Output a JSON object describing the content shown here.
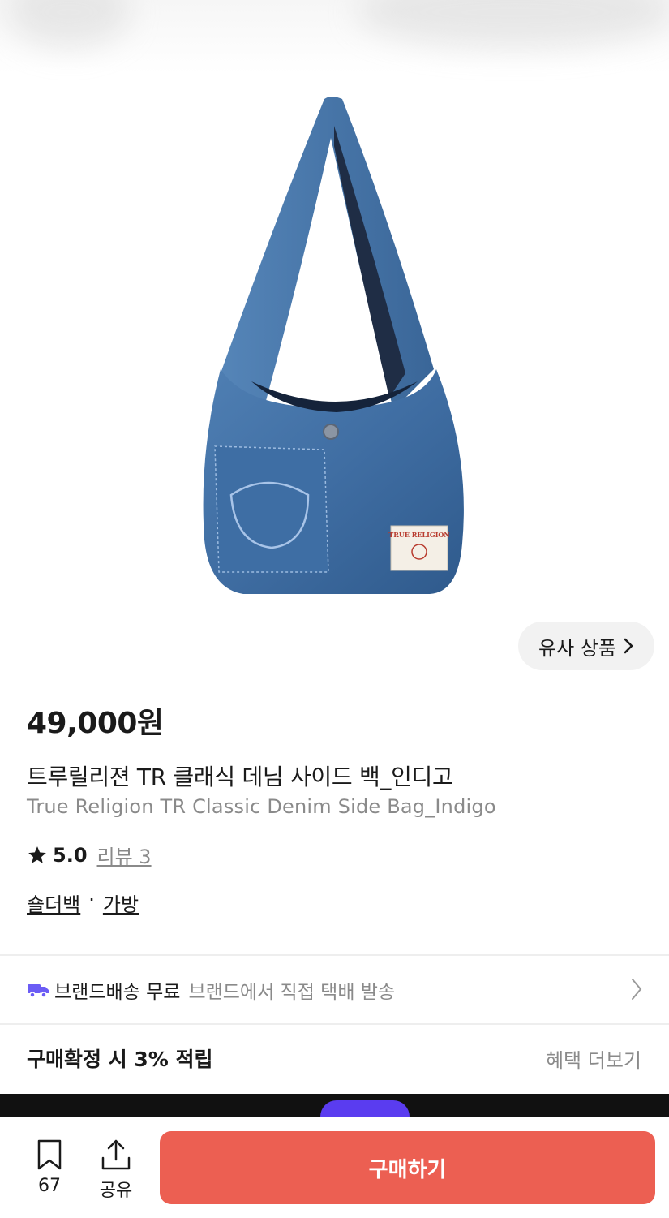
{
  "product": {
    "price": "49,000원",
    "name_ko": "트루릴리젼 TR 클래식 데님 사이드 백_인디고",
    "name_en": "True Religion TR Classic Denim Side Bag_Indigo",
    "rating": "5.0",
    "reviews": "리뷰 3",
    "categories": [
      "숄더백",
      "가방"
    ],
    "category_separator": "·",
    "label_brand": "TRUE RELIGION"
  },
  "similar_button": {
    "label": "유사 상품",
    "icon": "chevron-right-icon"
  },
  "delivery": {
    "title": "브랜드배송 무료",
    "subtitle": "브랜드에서 직접 택배 발송",
    "icon": "truck-icon",
    "icon_color": "#6b5cf5"
  },
  "points": {
    "title": "구매확정 시 3% 적립",
    "more": "혜택 더보기"
  },
  "bottom_bar": {
    "save_count": "67",
    "share_label": "공유",
    "buy_label": "구매하기",
    "buy_color": "#ec5f52"
  }
}
